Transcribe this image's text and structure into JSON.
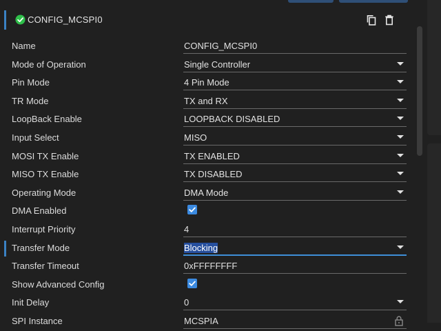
{
  "panel": {
    "title": "CONFIG_MCSPI0"
  },
  "fields": [
    {
      "key": "name",
      "label": "Name",
      "type": "text",
      "value": "CONFIG_MCSPI0"
    },
    {
      "key": "mode-of-operation",
      "label": "Mode of Operation",
      "type": "select",
      "value": "Single Controller"
    },
    {
      "key": "pin-mode",
      "label": "Pin Mode",
      "type": "select",
      "value": "4 Pin Mode"
    },
    {
      "key": "tr-mode",
      "label": "TR Mode",
      "type": "select",
      "value": "TX and RX"
    },
    {
      "key": "loopback-enable",
      "label": "LoopBack Enable",
      "type": "select",
      "value": "LOOPBACK DISABLED"
    },
    {
      "key": "input-select",
      "label": "Input Select",
      "type": "select",
      "value": "MISO"
    },
    {
      "key": "mosi-tx-enable",
      "label": "MOSI TX Enable",
      "type": "select",
      "value": "TX ENABLED"
    },
    {
      "key": "miso-tx-enable",
      "label": "MISO TX Enable",
      "type": "select",
      "value": "TX DISABLED"
    },
    {
      "key": "operating-mode",
      "label": "Operating Mode",
      "type": "select",
      "value": "DMA Mode"
    },
    {
      "key": "dma-enabled",
      "label": "DMA Enabled",
      "type": "checkbox",
      "checked": true
    },
    {
      "key": "interrupt-priority",
      "label": "Interrupt Priority",
      "type": "number",
      "value": "4"
    },
    {
      "key": "transfer-mode",
      "label": "Transfer Mode",
      "type": "select",
      "value": "Blocking",
      "focused": true
    },
    {
      "key": "transfer-timeout",
      "label": "Transfer Timeout",
      "type": "text",
      "value": "0xFFFFFFFF"
    },
    {
      "key": "show-advanced-config",
      "label": "Show Advanced Config",
      "type": "checkbox",
      "checked": true
    },
    {
      "key": "init-delay",
      "label": "Init Delay",
      "type": "select",
      "value": "0"
    },
    {
      "key": "spi-instance",
      "label": "SPI Instance",
      "type": "select",
      "value": "MCSPIA",
      "locked": true
    }
  ],
  "colors": {
    "background": "#202020",
    "accent": "#3b82c4",
    "checkbox": "#3b8ae0",
    "selection": "#264f9e",
    "status_ok": "#2fbf4a"
  },
  "icons": {
    "status": "check-circle-icon",
    "copy": "copy-icon",
    "delete": "trash-icon",
    "dropdown": "chevron-down-icon",
    "lock": "lock-icon"
  }
}
